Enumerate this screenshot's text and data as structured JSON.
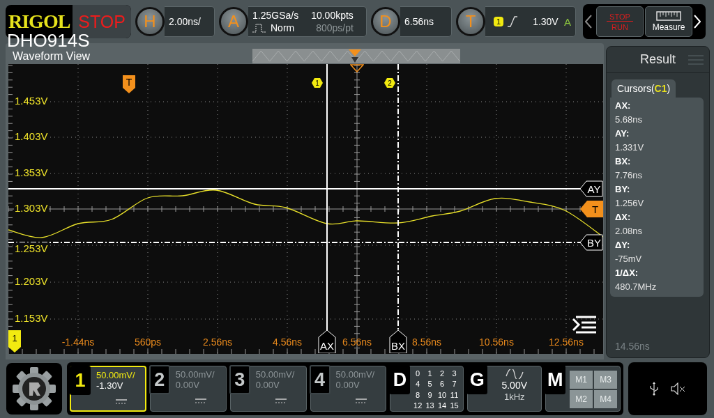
{
  "brand": {
    "logo": "RIGOL",
    "model": "DHO914S"
  },
  "run_state": {
    "label": "STOP"
  },
  "horizontal": {
    "key": "H",
    "timebase": "2.00ns/"
  },
  "acquisition": {
    "key": "A",
    "sample_rate": "1.25GSa/s",
    "mode": "Norm",
    "depth": "10.00kpts",
    "resolution": "800ps/pt"
  },
  "delay": {
    "key": "D",
    "value": "6.56ns"
  },
  "trigger": {
    "key": "T",
    "source": "1",
    "level": "1.30V",
    "sweep": "A"
  },
  "quick_buttons": [
    {
      "kind": "run_stop",
      "label": "STOP",
      "label2": "RUN"
    },
    {
      "kind": "measure",
      "label": "Measure"
    }
  ],
  "waveform_view": {
    "title": "Waveform View",
    "y_labels": [
      "1.453V",
      "1.403V",
      "1.353V",
      "1.303V",
      "1.253V",
      "1.203V",
      "1.153V"
    ],
    "x_labels": [
      "-1.44ns",
      "560ps",
      "2.56ns",
      "4.56ns",
      "6.56ns",
      "8.56ns",
      "10.56ns",
      "12.56ns"
    ],
    "trigger_marker": "T",
    "trigger_level_tag": "T",
    "channel_marker": "1",
    "cursor_markers": [
      "1",
      "2"
    ],
    "cursors": [
      {
        "label": "AY",
        "kind": "horizontal",
        "dashed": false
      },
      {
        "label": "BY",
        "kind": "horizontal",
        "dashed": true
      },
      {
        "label": "AX",
        "kind": "vertical",
        "dashed": false
      },
      {
        "label": "BX",
        "kind": "vertical",
        "dashed": true
      }
    ]
  },
  "result": {
    "title": "Result",
    "tab": "Cursors(**C1**)",
    "rows": [
      {
        "label": "AX:",
        "value": "5.68ns"
      },
      {
        "label": "AY:",
        "value": "1.331V"
      },
      {
        "label": "BX:",
        "value": "7.76ns"
      },
      {
        "label": "BY:",
        "value": "1.256V"
      },
      {
        "label": "ΔX:",
        "value": "2.08ns"
      },
      {
        "label": "ΔY:",
        "value": "-75mV"
      },
      {
        "label": "1/ΔX:",
        "value": "480.7MHz"
      }
    ],
    "background_label": "14.56ns"
  },
  "channels": [
    {
      "number": "1",
      "scale": "50.00mV/",
      "offset": "-1.30V",
      "selected": true
    },
    {
      "number": "2",
      "scale": "50.00mV/",
      "offset": "0.00V",
      "selected": false
    },
    {
      "number": "3",
      "scale": "50.00mV/",
      "offset": "0.00V",
      "selected": false
    },
    {
      "number": "4",
      "scale": "50.00mV/",
      "offset": "0.00V",
      "selected": false
    }
  ],
  "digital": {
    "key": "D",
    "bits": [
      "0",
      "1",
      "2",
      "3",
      "4",
      "5",
      "6",
      "7",
      "8",
      "9",
      "10",
      "11",
      "12",
      "13",
      "14",
      "15"
    ]
  },
  "generator": {
    "key": "G",
    "amplitude": "5.00V",
    "frequency": "1kHz"
  },
  "math": {
    "key": "M",
    "slots": [
      "M1",
      "M3",
      "M2",
      "M4"
    ]
  }
}
